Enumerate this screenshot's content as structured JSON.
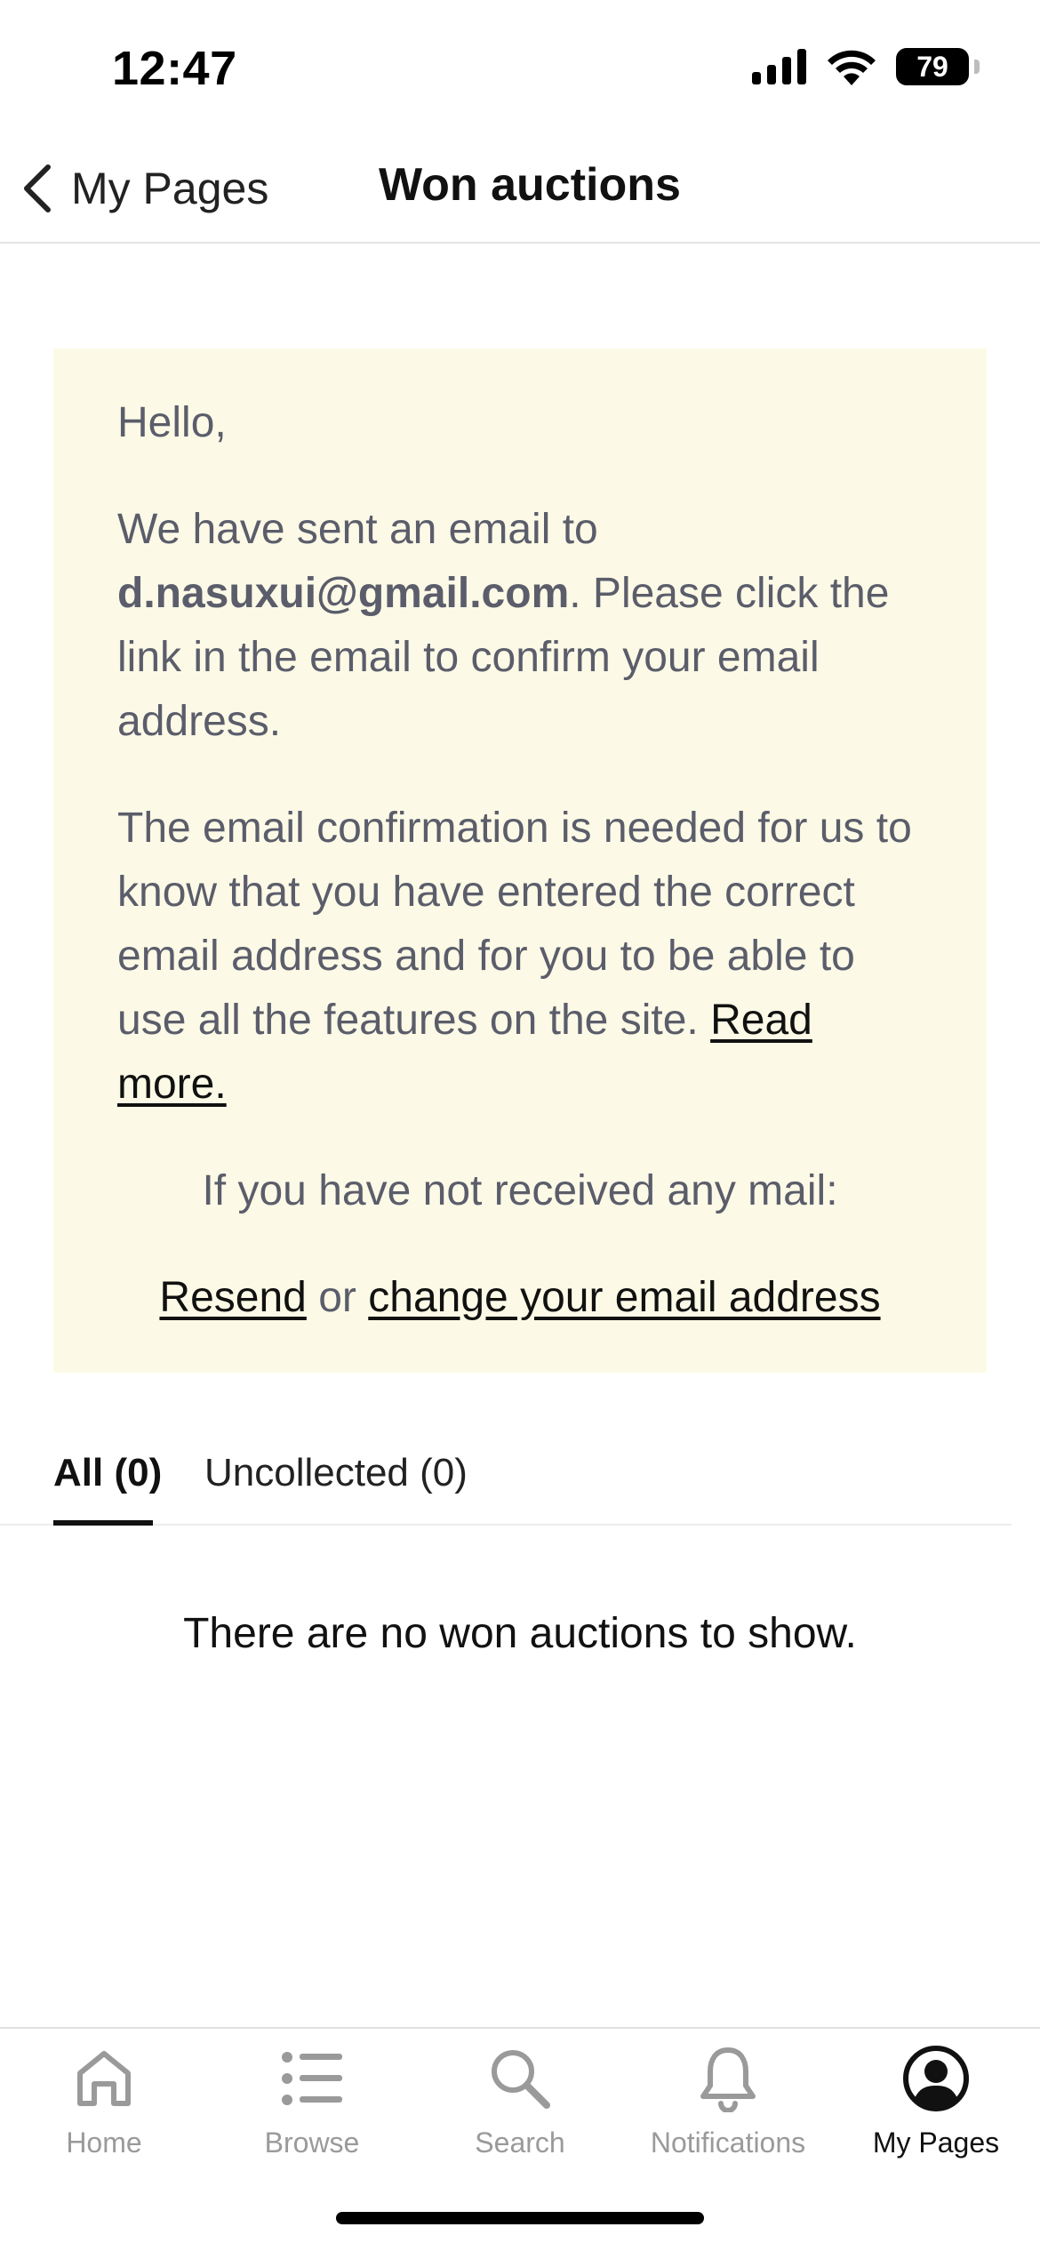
{
  "status_bar": {
    "time": "12:47",
    "battery": "79"
  },
  "header": {
    "back_label": "My Pages",
    "title": "Won auctions"
  },
  "notice": {
    "greeting": "Hello,",
    "sent_prefix": "We have sent an email to",
    "email": "d.nasuxui@gmail.com",
    "sent_suffix": ". Please click the link in the email to confirm your email address.",
    "explanation": "The email confirmation is needed for us to know that you have entered the correct email address and for you to be able to use all the features on the site.",
    "read_more": "Read more.",
    "not_received": "If you have not received any mail:",
    "resend": "Resend",
    "or": "or",
    "change_email": "change your email address"
  },
  "tabs": [
    {
      "label": "All (0)",
      "active": true
    },
    {
      "label": "Uncollected (0)",
      "active": false
    }
  ],
  "empty_message": "There are no won auctions to show.",
  "tabbar": {
    "items": [
      {
        "label": "Home",
        "icon": "home-icon",
        "active": false
      },
      {
        "label": "Browse",
        "icon": "list-icon",
        "active": false
      },
      {
        "label": "Search",
        "icon": "search-icon",
        "active": false
      },
      {
        "label": "Notifications",
        "icon": "bell-icon",
        "active": false
      },
      {
        "label": "My Pages",
        "icon": "account-icon",
        "active": true
      }
    ]
  },
  "colors": {
    "notice_background": "#fcfae6",
    "notice_text": "#5b5d6b",
    "inactive_tab": "#9a9a9a",
    "active_tab": "#111111"
  }
}
